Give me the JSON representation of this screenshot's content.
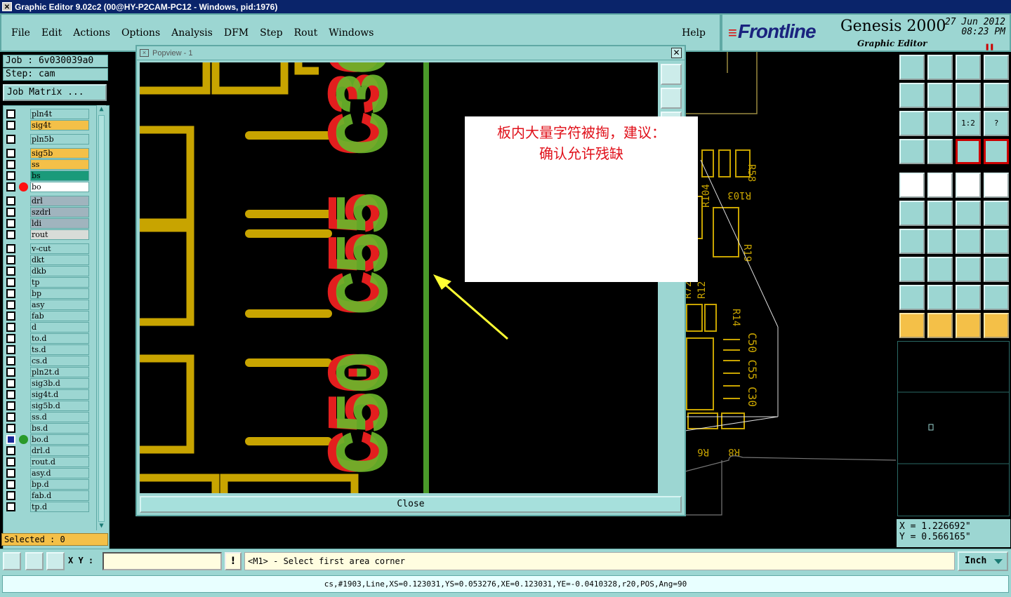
{
  "window": {
    "title": "Graphic Editor 9.02c2 (00@HY-P2CAM-PC12 - Windows, pid:1976)"
  },
  "menu": [
    "File",
    "Edit",
    "Actions",
    "Options",
    "Analysis",
    "DFM",
    "Step",
    "Rout",
    "Windows"
  ],
  "help_label": "Help",
  "brand": {
    "logo": "Frontline",
    "product": "Genesis 2000",
    "subtitle": "Graphic Editor",
    "date": "27 Jun 2012",
    "time": "08:23 PM",
    "logo_color": "#1a237e",
    "accent": "#d11111"
  },
  "job": {
    "job_label": "Job : 6v030039a0",
    "step_label": "Step: cam",
    "matrix_button": "Job Matrix ..."
  },
  "layers": [
    {
      "name": "pln4t",
      "color": "#9cd6d2"
    },
    {
      "name": "sig4t",
      "color": "#f4c048"
    },
    {
      "name": "pln5b",
      "color": "#9cd6d2"
    },
    {
      "name": "sig5b",
      "color": "#f4c048"
    },
    {
      "name": "ss",
      "color": "#f4c048"
    },
    {
      "name": "bs",
      "color": "#1a9a7a"
    },
    {
      "name": "bo",
      "color": "#ffffff",
      "dot": "#ff1111"
    },
    {
      "name": "drl",
      "color": "#a0b4be"
    },
    {
      "name": "szdrl",
      "color": "#a0b4be"
    },
    {
      "name": "ldi",
      "color": "#a0b4be"
    },
    {
      "name": "rout",
      "color": "#d8dcd8"
    },
    {
      "name": "v-cut",
      "color": "#9cd6d2"
    },
    {
      "name": "dkt",
      "color": "#9cd6d2"
    },
    {
      "name": "dkb",
      "color": "#9cd6d2"
    },
    {
      "name": "tp",
      "color": "#9cd6d2"
    },
    {
      "name": "bp",
      "color": "#9cd6d2"
    },
    {
      "name": "asy",
      "color": "#9cd6d2"
    },
    {
      "name": "fab",
      "color": "#9cd6d2"
    },
    {
      "name": "d",
      "color": "#9cd6d2"
    },
    {
      "name": "to.d",
      "color": "#9cd6d2"
    },
    {
      "name": "ts.d",
      "color": "#9cd6d2"
    },
    {
      "name": "cs.d",
      "color": "#9cd6d2"
    },
    {
      "name": "pln2t.d",
      "color": "#9cd6d2"
    },
    {
      "name": "sig3b.d",
      "color": "#9cd6d2"
    },
    {
      "name": "sig4t.d",
      "color": "#9cd6d2"
    },
    {
      "name": "sig5b.d",
      "color": "#9cd6d2"
    },
    {
      "name": "ss.d",
      "color": "#9cd6d2"
    },
    {
      "name": "bs.d",
      "color": "#9cd6d2"
    },
    {
      "name": "bo.d",
      "color": "#9cd6d2",
      "dot": "#2a9a2a",
      "active": true
    },
    {
      "name": "drl.d",
      "color": "#9cd6d2"
    },
    {
      "name": "rout.d",
      "color": "#9cd6d2"
    },
    {
      "name": "asy.d",
      "color": "#9cd6d2"
    },
    {
      "name": "bp.d",
      "color": "#9cd6d2"
    },
    {
      "name": "fab.d",
      "color": "#9cd6d2"
    },
    {
      "name": "tp.d",
      "color": "#9cd6d2"
    }
  ],
  "selected": "Selected : 0",
  "popview": {
    "title": "Popview - 1",
    "close_label": "Close",
    "silk_text": "C50 C55 C30"
  },
  "annotation": {
    "line1": "板内大量字符被掏，建议：",
    "line2": "确认允许残缺",
    "color": "#e0101a",
    "arrow_color": "#ffff33"
  },
  "board_labels": {
    "r58": "R58",
    "r104": "R104",
    "r103": "R103",
    "r19": "R19",
    "r72": "R72",
    "r12": "R12",
    "r14": "R14",
    "silk": "C50 C55 C30",
    "r6": "R6",
    "r8": "R8"
  },
  "right_tools": [
    "zoom-home-icon",
    "zoom-back-icon",
    "home-view-icon",
    "split-view-icon",
    "pan-left-icon",
    "pan-right-icon",
    "mirror-icon",
    "rotate-icon",
    "fit-vertical-icon",
    "fit-all-icon",
    "scale-1-2-icon",
    "query-icon",
    "measure-tool-icon",
    "grid-icon",
    "layers-red-icon",
    "layers-net-icon",
    "add-feature-icon",
    "break-icon",
    "ruler-icon",
    "pad-icon",
    "connect-icon",
    "delete-node-icon",
    "move-point-icon",
    "move-point2-icon",
    "angle-icon",
    "line-icon",
    "arc-icon",
    "snap-flip-icon",
    "transform-icon",
    "minus-icon",
    "center-icon",
    "pad-group-icon",
    "triangle-icon",
    "triangle-a-icon",
    "triangle-a-boxed-icon",
    "triangle-a-line-icon",
    "select-pointer-icon",
    "select-box-icon",
    "select-pointer-boxed-icon",
    "select-path-icon"
  ],
  "right_tools_scale_label": "1:2",
  "right_tools_query_label": "?",
  "coords": {
    "x": "X = 1.226692\"",
    "y": "Y = 0.566165\""
  },
  "bottom": {
    "xy_label": "X Y :",
    "warn": "!",
    "prompt": "<M1> - Select first area corner",
    "unit": "Inch"
  },
  "status": "cs,#1903,Line,XS=0.123031,YS=0.053276,XE=0.123031,YE=-0.0410328,r20,POS,Ang=90"
}
